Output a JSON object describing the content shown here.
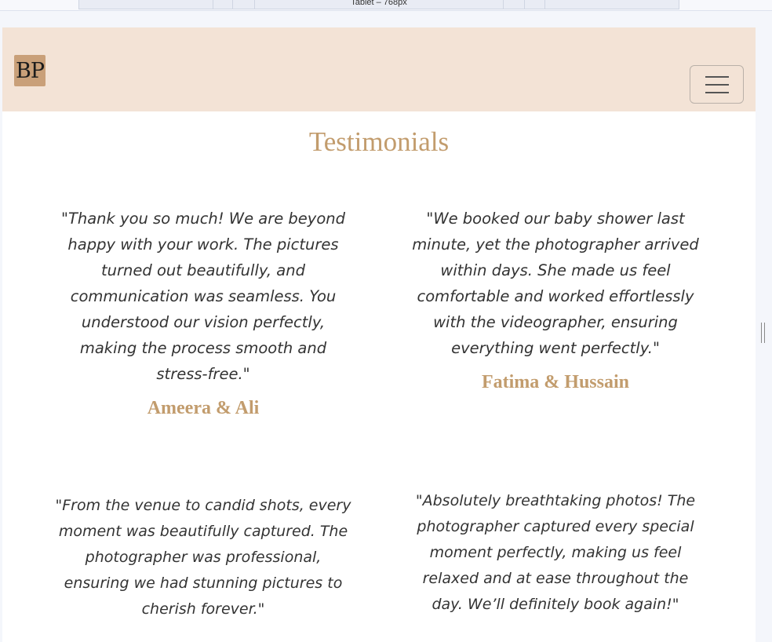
{
  "devtools": {
    "device_label": "Tablet – 768px"
  },
  "navbar": {
    "logo_text": "BP"
  },
  "section": {
    "title": "Testimonials"
  },
  "testimonials": [
    {
      "quote": "\"Thank you so much! We are beyond happy with your work. The pictures turned out beautifully, and communication was seamless. You understood our vision perfectly, making the process smooth and stress-free.\"",
      "name": "Ameera & Ali"
    },
    {
      "quote": "\"We booked our baby shower last minute, yet the photographer arrived within days. She made us feel comfortable and worked effortlessly with the videographer, ensuring everything went perfectly.\"",
      "name": "Fatima & Hussain"
    },
    {
      "quote": "\"From the venue to candid shots, every moment was beautifully captured. The photographer was professional, ensuring we had stunning pictures to cherish forever.\"",
      "name": ""
    },
    {
      "quote": "\"Absolutely breathtaking photos! The photographer captured every special moment perfectly, making us feel relaxed and at ease throughout the day. We’ll definitely book again!\"",
      "name": ""
    }
  ],
  "colors": {
    "navbar_bg": "#f3e3d6",
    "accent": "#c29c6d",
    "logo_bg": "#c9a079",
    "text": "#333333"
  },
  "icons": {
    "menu": "hamburger-icon",
    "resize": "resize-handle-icon"
  }
}
